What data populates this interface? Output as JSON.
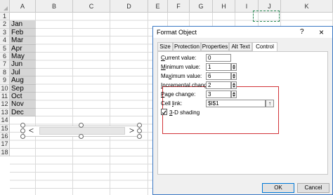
{
  "sheet": {
    "columns": [
      "A",
      "B",
      "C",
      "D",
      "E",
      "F",
      "G",
      "H",
      "I",
      "J",
      "K"
    ],
    "rows": [
      "1",
      "2",
      "3",
      "4",
      "5",
      "6",
      "7",
      "8",
      "9",
      "10",
      "11",
      "12",
      "13",
      "14",
      "15",
      "16",
      "17",
      "18"
    ],
    "months": [
      "Jan",
      "Feb",
      "Mar",
      "Apr",
      "May",
      "Jun",
      "Jul",
      "Aug",
      "Sep",
      "Oct",
      "Nov",
      "Dec"
    ],
    "scrollbar": {
      "left_arrow": "<",
      "right_arrow": ">"
    }
  },
  "dialog": {
    "title": "Format Object",
    "help": "?",
    "close": "×",
    "tabs": [
      {
        "label": "Size",
        "active": false
      },
      {
        "label": "Protection",
        "active": false
      },
      {
        "label": "Properties",
        "active": false
      },
      {
        "label": "Alt Text",
        "active": false
      },
      {
        "label": "Control",
        "active": true
      }
    ],
    "current_value": {
      "pre": "",
      "ul": "C",
      "post": "urrent value:",
      "value": "0"
    },
    "minimum_value": {
      "pre": "",
      "ul": "M",
      "post": "inimum value:",
      "value": "1"
    },
    "maximum_value": {
      "pre": "Ma",
      "ul": "x",
      "post": "imum value:",
      "value": "6"
    },
    "incremental_change": {
      "pre": "",
      "ul": "I",
      "post": "ncremental change:",
      "value": "2"
    },
    "page_change": {
      "pre": "",
      "ul": "P",
      "post": "age change:",
      "value": "3"
    },
    "cell_link": {
      "pre": "Cell ",
      "ul": "l",
      "post": "ink:",
      "value": "$I$1",
      "picker": "↑"
    },
    "shading": {
      "pre": "",
      "ul": "3",
      "post": "-D shading",
      "checked": true
    },
    "buttons": {
      "ok": "OK",
      "cancel": "Cancel"
    },
    "accent_color": "#d13438"
  }
}
